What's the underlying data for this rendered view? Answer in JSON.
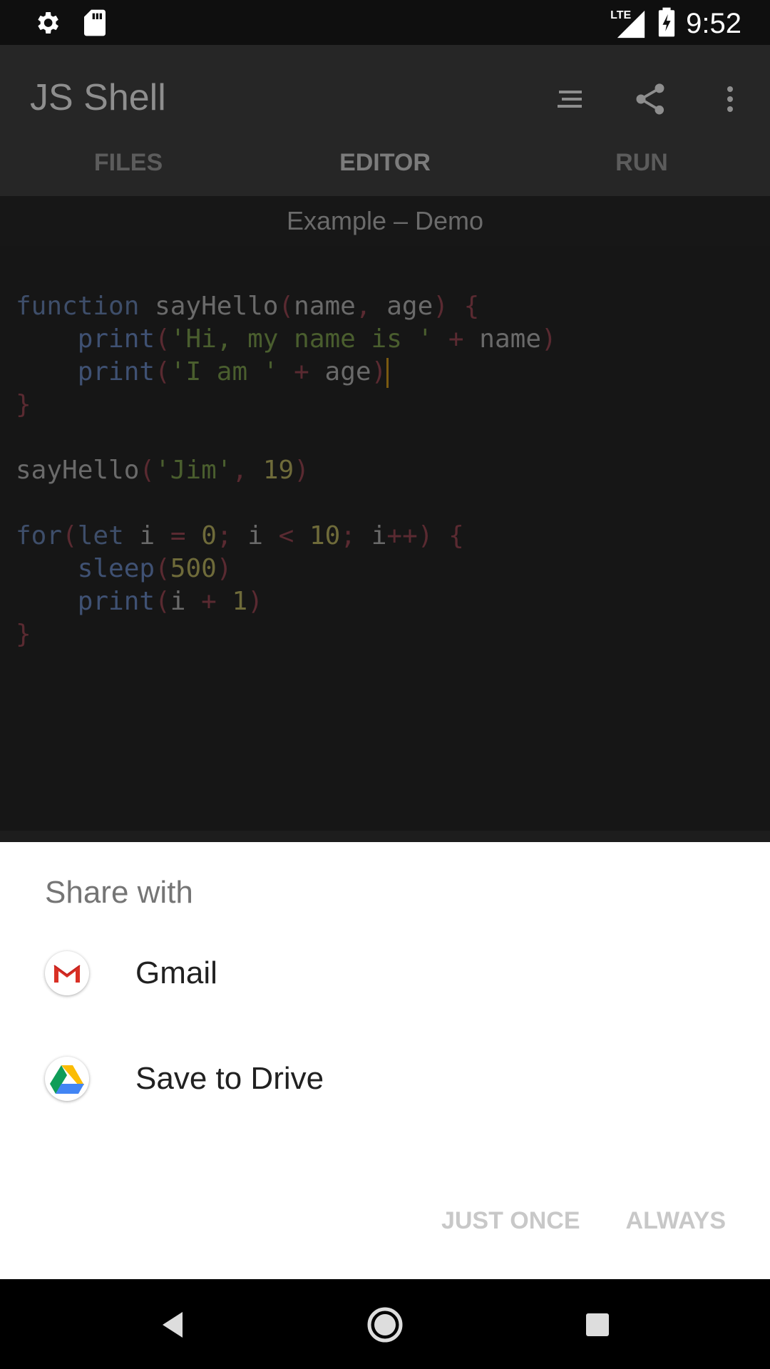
{
  "status_bar": {
    "time": "9:52",
    "network": "LTE",
    "left_icons": [
      "settings-icon",
      "sd-card-icon"
    ],
    "right_icons": [
      "signal-icon",
      "battery-charging-icon"
    ]
  },
  "app_bar": {
    "title": "JS Shell",
    "actions": [
      "format-icon",
      "share-icon",
      "more-vert-icon"
    ]
  },
  "tabs": [
    {
      "label": "FILES",
      "active": false
    },
    {
      "label": "EDITOR",
      "active": true
    },
    {
      "label": "RUN",
      "active": false
    }
  ],
  "editor": {
    "file_label": "Example – Demo",
    "code_lines": [
      "function sayHello(name, age) {",
      "    print('Hi, my name is ' + name)",
      "    print('I am ' + age)",
      "}",
      "",
      "sayHello('Jim', 19)",
      "",
      "for(let i = 0; i < 10; i++) {",
      "    sleep(500)",
      "    print(i + 1)",
      "}"
    ]
  },
  "share_sheet": {
    "title": "Share with",
    "items": [
      {
        "label": "Gmail",
        "icon": "gmail-icon"
      },
      {
        "label": "Save to Drive",
        "icon": "google-drive-icon"
      }
    ],
    "buttons": {
      "just_once": "JUST ONCE",
      "always": "ALWAYS"
    }
  },
  "nav_bar": {
    "buttons": [
      "back-icon",
      "home-icon",
      "recents-icon"
    ]
  },
  "colors": {
    "tab_indicator": "#6a4c10",
    "sheet_background": "#ffffff",
    "disabled_button": "#c8c8c8"
  }
}
